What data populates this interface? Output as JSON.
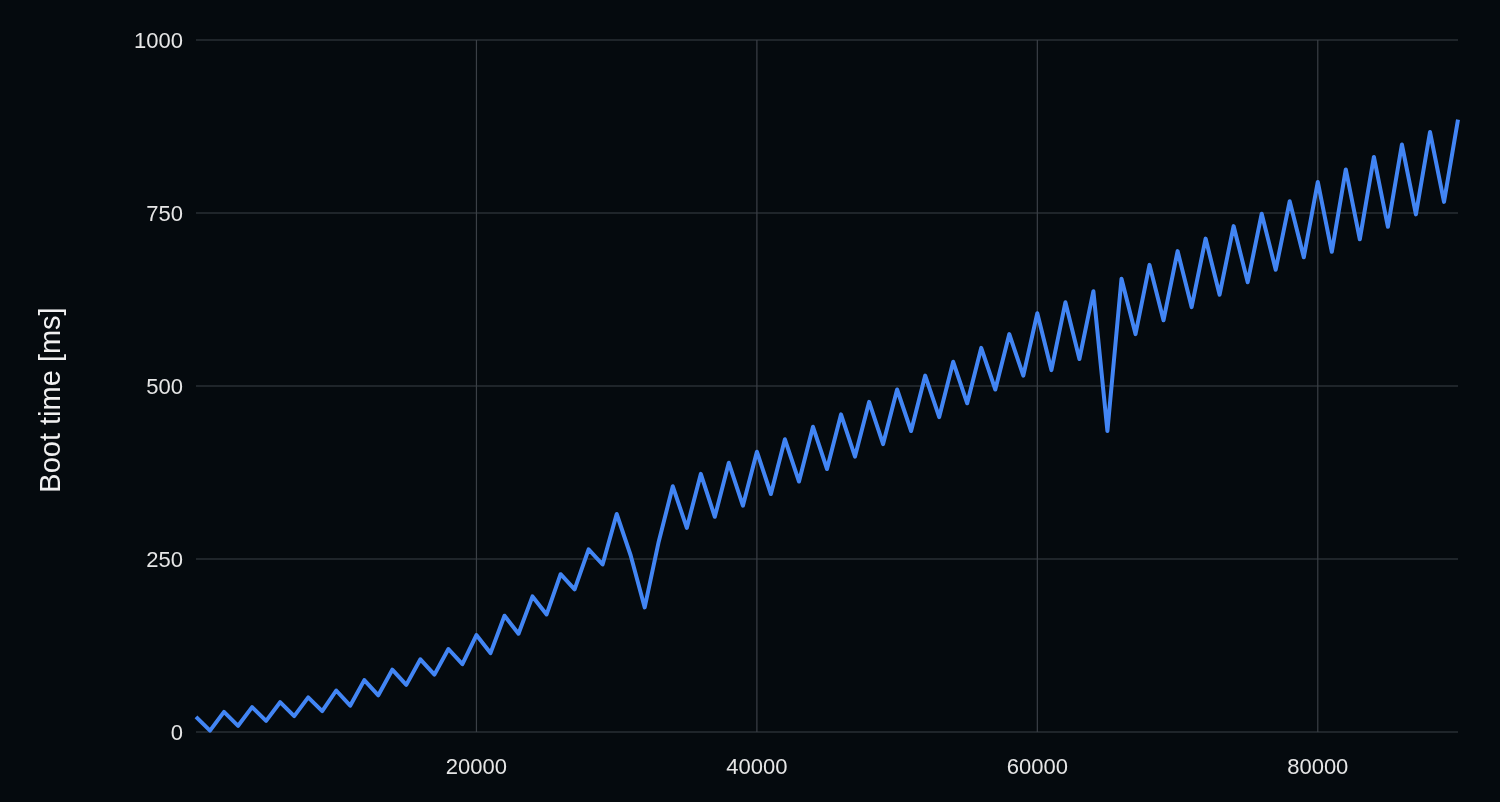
{
  "chart_data": {
    "type": "line",
    "grid": true,
    "ylabel": "Boot time [ms]",
    "xlim": [
      0,
      90000
    ],
    "ylim": [
      0,
      1000
    ],
    "xticks": [
      20000,
      40000,
      60000,
      80000
    ],
    "yticks": [
      0,
      250,
      500,
      750,
      1000
    ],
    "x": [
      0,
      1000,
      2000,
      3000,
      4000,
      5000,
      6000,
      7000,
      8000,
      9000,
      10000,
      11000,
      12000,
      13000,
      14000,
      15000,
      16000,
      17000,
      18000,
      19000,
      20000,
      21000,
      22000,
      23000,
      24000,
      25000,
      26000,
      27000,
      28000,
      29000,
      30000,
      31000,
      32000,
      33000,
      34000,
      35000,
      36000,
      37000,
      38000,
      39000,
      40000,
      41000,
      42000,
      43000,
      44000,
      45000,
      46000,
      47000,
      48000,
      49000,
      50000,
      51000,
      52000,
      53000,
      54000,
      55000,
      56000,
      57000,
      58000,
      59000,
      60000,
      61000,
      62000,
      63000,
      64000,
      65000,
      66000,
      67000,
      68000,
      69000,
      70000,
      71000,
      72000,
      73000,
      74000,
      75000,
      76000,
      77000,
      78000,
      79000,
      80000,
      81000,
      82000,
      83000,
      84000,
      85000,
      86000,
      87000,
      88000,
      89000,
      90000
    ],
    "series": [
      {
        "color": "#4285f4",
        "values": [
          22,
          2,
          29,
          9,
          36,
          16,
          43,
          23,
          50,
          30,
          60,
          38,
          75,
          53,
          90,
          68,
          105,
          83,
          120,
          98,
          140,
          114,
          168,
          142,
          196,
          170,
          228,
          206,
          264,
          242,
          315,
          255,
          180,
          275,
          355,
          295,
          373,
          311,
          389,
          327,
          405,
          344,
          423,
          362,
          441,
          380,
          459,
          398,
          477,
          416,
          495,
          435,
          515,
          455,
          535,
          475,
          555,
          495,
          575,
          515,
          605,
          523,
          621,
          539,
          637,
          435,
          655,
          575,
          675,
          595,
          695,
          614,
          713,
          632,
          731,
          650,
          749,
          668,
          767,
          686,
          795,
          694,
          813,
          712,
          831,
          730,
          849,
          748,
          867,
          766,
          885
        ]
      }
    ]
  }
}
